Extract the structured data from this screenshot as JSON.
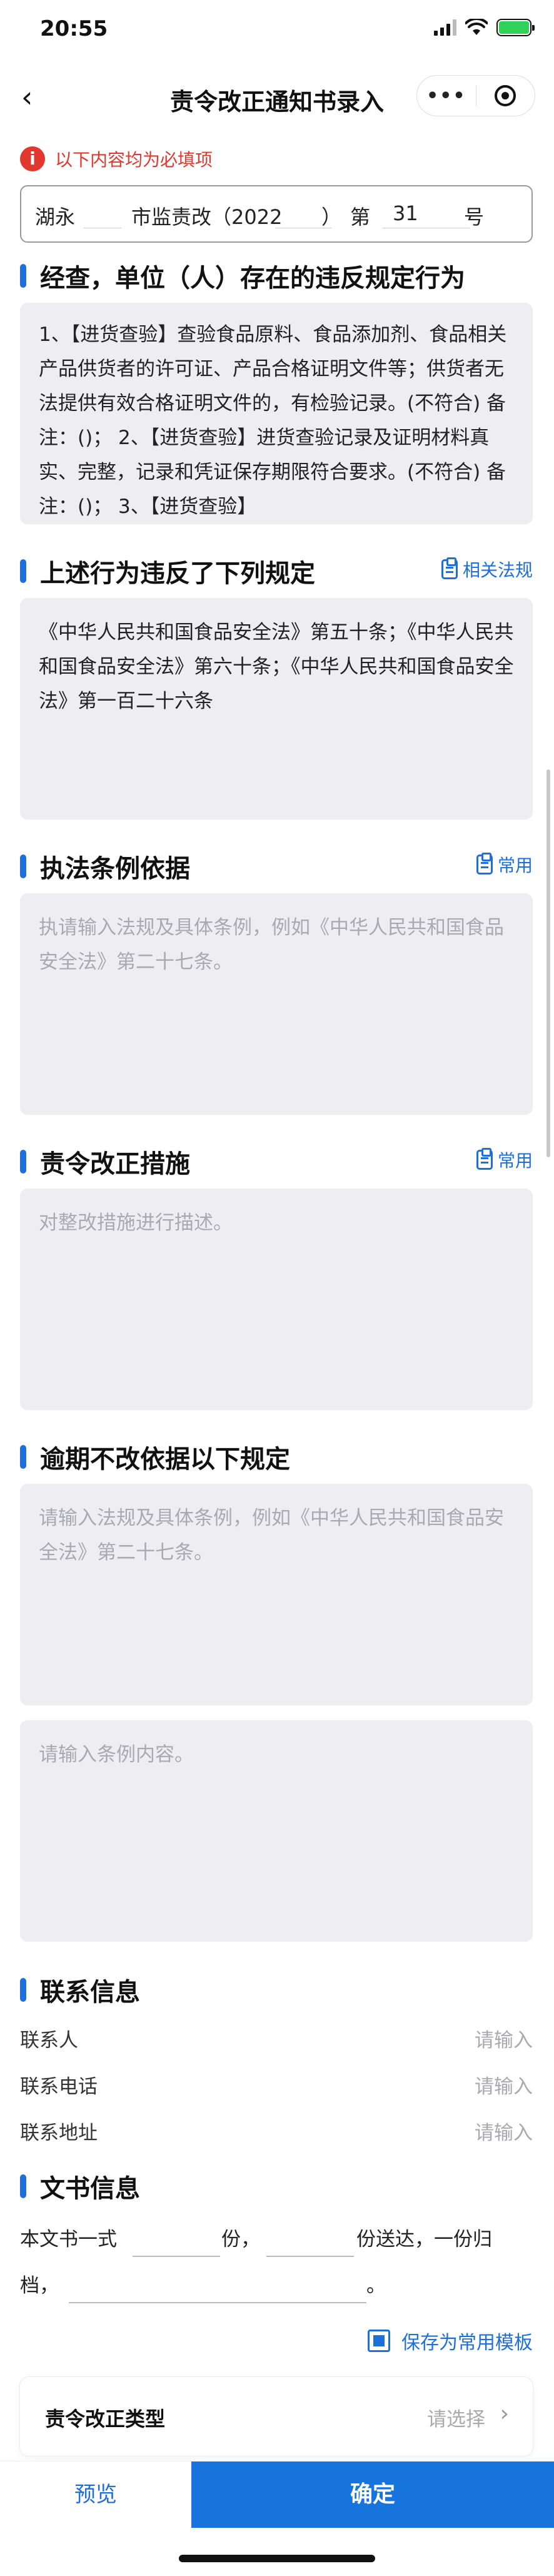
{
  "status_bar": {
    "time": "20:55"
  },
  "nav": {
    "back": "‹",
    "title": "责令改正通知书录入",
    "more": "•••"
  },
  "required_tip": {
    "icon": "i",
    "text": "以下内容均为必填项"
  },
  "doc_number": {
    "prefix": "湖永",
    "middle": "市监责改（2022",
    "close_paren": "）",
    "di": "第",
    "num": "31",
    "hao": "号"
  },
  "sections": {
    "violation": {
      "title": "经查，单位（人）存在的违反规定行为",
      "content": "1、【进货查验】查验食品原料、食品添加剂、食品相关产品供货者的许可证、产品合格证明文件等；供货者无法提供有效合格证明文件的，有检验记录。(不符合) 备注：()；  2、【进货查验】进货查验记录及证明材料真实、完整，记录和凭证保存期限符合要求。(不符合) 备注：()；  3、【进货查验】"
    },
    "regulations": {
      "title": "上述行为违反了下列规定",
      "link": "相关法规",
      "content": "《中华人民共和国食品安全法》第五十条；《中华人民共和国食品安全法》第六十条；《中华人民共和国食品安全法》第一百二十六条"
    },
    "basis": {
      "title": "执法条例依据",
      "link": "常用",
      "placeholder": "执请输入法规及具体条例，例如《中华人民共和国食品安全法》第二十七条。"
    },
    "measures": {
      "title": "责令改正措施",
      "link": "常用",
      "placeholder": "对整改措施进行描述。"
    },
    "overdue": {
      "title": "逾期不改依据以下规定",
      "placeholder1": "请输入法规及具体条例，例如《中华人民共和国食品安全法》第二十七条。",
      "placeholder2": "请输入条例内容。"
    }
  },
  "contact": {
    "title": "联系信息",
    "rows": [
      {
        "label": "联系人",
        "value": "请输入"
      },
      {
        "label": "联系电话",
        "value": "请输入"
      },
      {
        "label": "联系地址",
        "value": "请输入"
      }
    ]
  },
  "doc_info": {
    "title": "文书信息",
    "t1": "本文书一式",
    "t2": "份，",
    "t3": "份送达，一份归",
    "t4": "档，",
    "t5": "。"
  },
  "save_template": "保存为常用模板",
  "type_select": {
    "label": "责令改正类型",
    "value": "请选择",
    "chevron": "›"
  },
  "bottom": {
    "preview": "预览",
    "confirm": "确定"
  }
}
